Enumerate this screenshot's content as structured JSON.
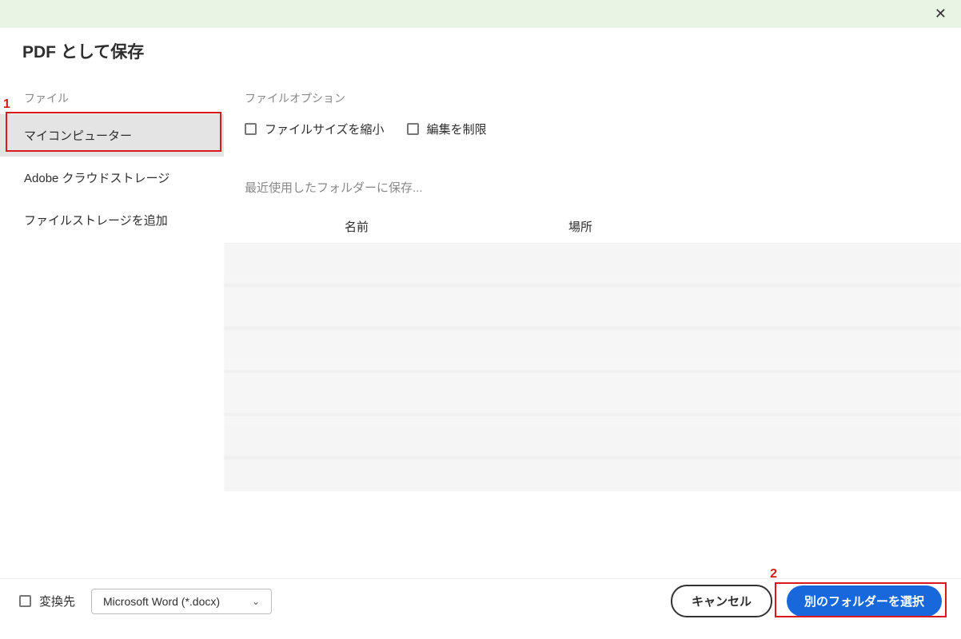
{
  "dialog": {
    "title": "PDF として保存"
  },
  "sidebar": {
    "header": "ファイル",
    "items": [
      {
        "label": "マイコンピューター"
      },
      {
        "label": "Adobe クラウドストレージ"
      },
      {
        "label": "ファイルストレージを追加"
      }
    ]
  },
  "content": {
    "file_options_label": "ファイルオプション",
    "reduce_size_label": "ファイルサイズを縮小",
    "restrict_edit_label": "編集を制限",
    "recent_folders_label": "最近使用したフォルダーに保存...",
    "col_name": "名前",
    "col_location": "場所"
  },
  "footer": {
    "convert_to_label": "変換先",
    "convert_format": "Microsoft Word (*.docx)",
    "cancel_label": "キャンセル",
    "choose_folder_label": "別のフォルダーを選択"
  },
  "annotations": {
    "label1": "1",
    "label2": "2"
  }
}
